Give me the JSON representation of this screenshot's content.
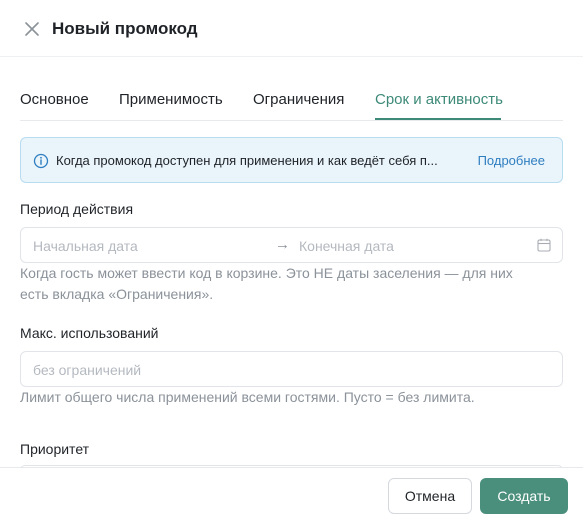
{
  "header": {
    "title": "Новый промокод",
    "close_icon": "close-icon"
  },
  "tabs": [
    {
      "label": "Основное"
    },
    {
      "label": "Применимость"
    },
    {
      "label": "Ограничения"
    },
    {
      "label": "Срок и активность",
      "active": true
    }
  ],
  "info": {
    "text": "Когда промокод доступен для применения и как ведёт себя п...",
    "link": "Подробнее",
    "icon": "info-circle-icon"
  },
  "period": {
    "label": "Период действия",
    "start_placeholder": "Начальная дата",
    "end_placeholder": "Конечная дата",
    "arrow": "→",
    "icon": "calendar-icon",
    "help_line1": "Когда гость может ввести код в корзине. Это НЕ даты заселения — для них",
    "help_line2": "есть вкладка «Ограничения»."
  },
  "max_uses": {
    "label": "Макс. использований",
    "placeholder": "без ограничений",
    "help": "Лимит общего числа применений всеми гостями. Пусто = без лимита."
  },
  "priority": {
    "label": "Приоритет"
  },
  "footer": {
    "cancel_label": "Отмена",
    "create_label": "Создать"
  },
  "colors": {
    "accent": "#3d8a78",
    "primary_button": "#4a8f7c",
    "info_bg": "#e9f4fb",
    "link": "#2f7ec0"
  }
}
